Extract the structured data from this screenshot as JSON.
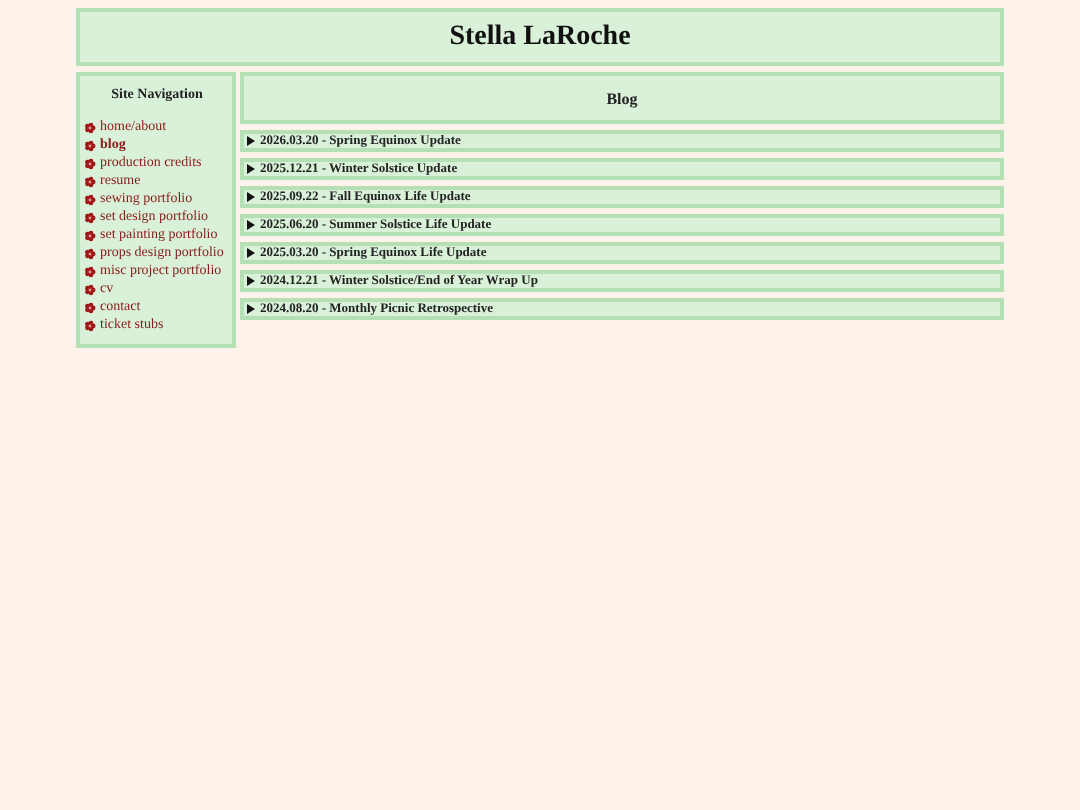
{
  "header": {
    "title": "Stella LaRoche"
  },
  "sidebar": {
    "title": "Site Navigation",
    "items": [
      {
        "label": "home/about",
        "selected": false
      },
      {
        "label": "blog",
        "selected": true
      },
      {
        "label": "production credits",
        "selected": false
      },
      {
        "label": "resume",
        "selected": false
      },
      {
        "label": "sewing portfolio",
        "selected": false
      },
      {
        "label": "set design portfolio",
        "selected": false
      },
      {
        "label": "set painting portfolio",
        "selected": false
      },
      {
        "label": "props design portfolio",
        "selected": false
      },
      {
        "label": "misc project portfolio",
        "selected": false
      },
      {
        "label": "cv",
        "selected": false
      },
      {
        "label": "contact",
        "selected": false
      },
      {
        "label": "ticket stubs",
        "selected": false
      }
    ]
  },
  "main": {
    "title": "Blog",
    "posts": [
      {
        "label": "2026.03.20 - Spring Equinox Update",
        "expanded": false
      },
      {
        "label": "2025.12.21 - Winter Solstice Update",
        "expanded": false
      },
      {
        "label": "2025.09.22 - Fall Equinox Life Update",
        "expanded": false
      },
      {
        "label": "2025.06.20 - Summer Solstice Life Update",
        "expanded": false
      },
      {
        "label": "2025.03.20 - Spring Equinox Life Update",
        "expanded": false
      },
      {
        "label": "2024.12.21 - Winter Solstice/End of Year Wrap Up",
        "expanded": false
      },
      {
        "label": "2024.08.20 - Monthly Picnic Retrospective",
        "expanded": false
      }
    ]
  }
}
